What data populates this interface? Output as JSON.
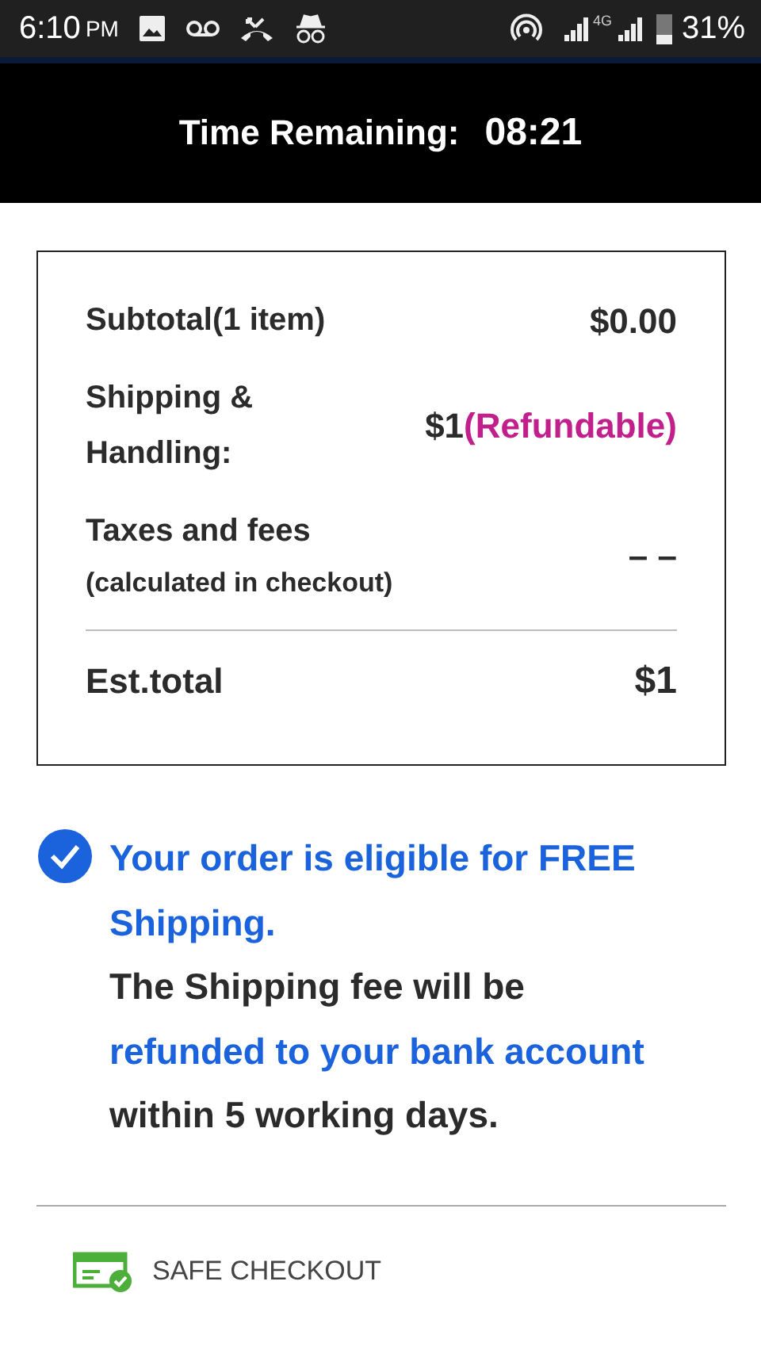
{
  "status_bar": {
    "time": "6:10",
    "meridiem": "PM",
    "network": "4G",
    "battery": "31%"
  },
  "timer": {
    "label": "Time Remaining:",
    "value": "08:21"
  },
  "summary": {
    "rows": [
      {
        "kind": "simple",
        "label": "Subtotal(1 item)",
        "value": "$0.00"
      },
      {
        "kind": "shipping",
        "label": "Shipping & Handling:",
        "value": "$1",
        "note": "(Refundable)"
      },
      {
        "kind": "taxes",
        "label": "Taxes and fees",
        "sublabel": "(calculated in checkout)",
        "value": "– –"
      }
    ],
    "total": {
      "label": "Est.total",
      "value": "$1"
    }
  },
  "notice": {
    "checked": true,
    "segments": [
      {
        "text": "Your order is eligible for FREE Shipping.",
        "highlighted": true
      },
      {
        "text": "The Shipping fee will be",
        "highlighted": false
      },
      {
        "text": "refunded to your bank account",
        "highlighted": true
      },
      {
        "text": "within 5 working days.",
        "highlighted": false
      }
    ]
  },
  "footer": {
    "label": "SAFE CHECKOUT"
  }
}
